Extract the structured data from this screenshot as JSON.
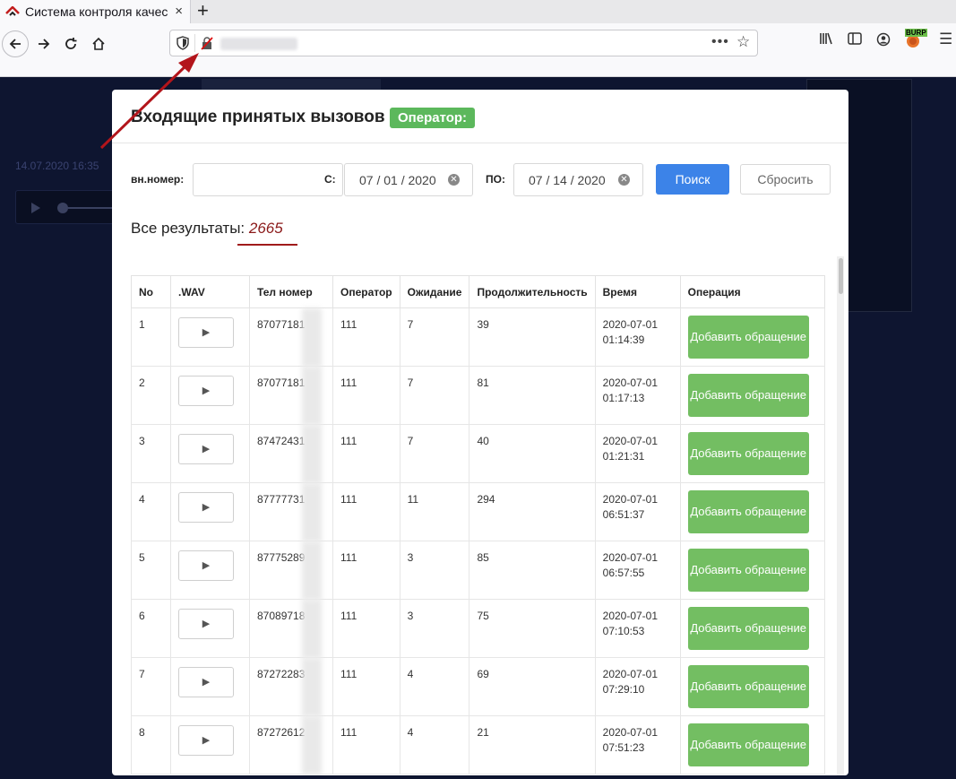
{
  "browser": {
    "tab_title": "Система контроля качес",
    "tab_close": "×",
    "new_tab": "+",
    "url_menu": "•••",
    "burp_label": "BURP"
  },
  "background": {
    "timestamp": "14.07.2020 16:35"
  },
  "modal": {
    "title": "Входящие принятых вызовов",
    "operator_badge": "Оператор:",
    "ext_label": "вн.номер:",
    "from_label": "С:",
    "from_date": "07 / 01 / 2020",
    "to_label": "ПО:",
    "to_date": "07 / 14 / 2020",
    "search_button": "Поиск",
    "reset_button": "Сбросить",
    "results_label": "Все результаты:",
    "results_count": "2665"
  },
  "table": {
    "headers": [
      "No",
      ".WAV",
      "Тел номер",
      "Оператор",
      "Ожидание",
      "Продолжительность",
      "Время",
      "Операция"
    ],
    "action_label": "Добавить обращение",
    "rows": [
      {
        "no": "1",
        "phone": "87077181",
        "operator": "111",
        "wait": "7",
        "duration": "39",
        "date": "2020-07-01",
        "time": "01:14:39"
      },
      {
        "no": "2",
        "phone": "87077181",
        "operator": "111",
        "wait": "7",
        "duration": "81",
        "date": "2020-07-01",
        "time": "01:17:13"
      },
      {
        "no": "3",
        "phone": "87472431",
        "operator": "111",
        "wait": "7",
        "duration": "40",
        "date": "2020-07-01",
        "time": "01:21:31"
      },
      {
        "no": "4",
        "phone": "87777731",
        "operator": "111",
        "wait": "11",
        "duration": "294",
        "date": "2020-07-01",
        "time": "06:51:37"
      },
      {
        "no": "5",
        "phone": "87775289",
        "operator": "111",
        "wait": "3",
        "duration": "85",
        "date": "2020-07-01",
        "time": "06:57:55"
      },
      {
        "no": "6",
        "phone": "87089718",
        "operator": "111",
        "wait": "3",
        "duration": "75",
        "date": "2020-07-01",
        "time": "07:10:53"
      },
      {
        "no": "7",
        "phone": "87272283",
        "operator": "111",
        "wait": "4",
        "duration": "69",
        "date": "2020-07-01",
        "time": "07:29:10"
      },
      {
        "no": "8",
        "phone": "87272612",
        "operator": "111",
        "wait": "4",
        "duration": "21",
        "date": "2020-07-01",
        "time": "07:51:23"
      }
    ]
  },
  "colors": {
    "accent_blue": "#3c83e8",
    "success_green": "#5cb85c",
    "annotation_red": "#b3151b"
  }
}
